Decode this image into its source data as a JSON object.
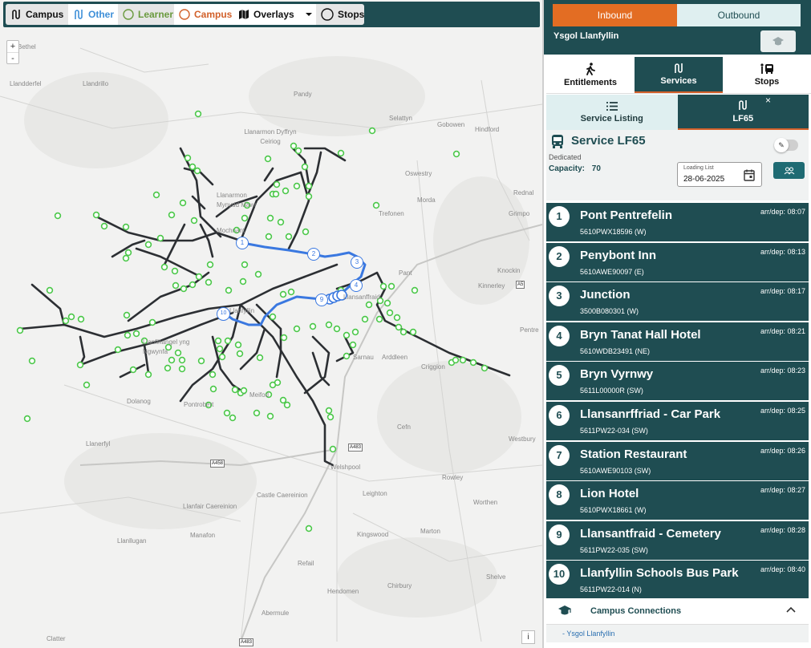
{
  "toolbar": {
    "campus_label": "Campus",
    "other_label": "Other",
    "learner_label": "Learner",
    "campus2_label": "Campus",
    "overlays_label": "Overlays",
    "stops_label": "Stops"
  },
  "map": {
    "zoom_in": "+",
    "zoom_out": "-",
    "info": "i",
    "places": [
      "Bethel",
      "Llandderfel",
      "Llandrillo",
      "Pandy",
      "Llanarmon Dyffryn Ceiriog",
      "Selattyn",
      "Gobowen",
      "Hindford",
      "Llanarmon Mynydd Mawr",
      "Oswestry",
      "Mochnant",
      "Morda",
      "Rednal",
      "Trefonen",
      "Grimpo",
      "Pant",
      "Knockin",
      "Kinnerley",
      "Llanfyllin",
      "Llanfihangel yng Ngwynfa",
      "Llansanffraid",
      "Arddleen",
      "Sarnau",
      "Criggion",
      "Pentre",
      "Dolanog",
      "Pontrobert",
      "Meifod",
      "Llanerfyl",
      "Cefn",
      "Welshpool",
      "Westbury",
      "Llanfair Caereinion",
      "Castle Caereinion",
      "Leighton",
      "Rowley",
      "Worthen",
      "Manafon",
      "Llanllugan",
      "Kingswood",
      "Marton",
      "Refail",
      "Chirbury",
      "Shelve",
      "Hendomen",
      "Abermule",
      "Clatter"
    ],
    "roads": [
      "A5",
      "A483",
      "A458",
      "A483"
    ],
    "route_stop_labels": [
      "1",
      "2",
      "3",
      "4",
      "9",
      "10"
    ]
  },
  "panel": {
    "inbound": "Inbound",
    "outbound": "Outbound",
    "school": "Ysgol Llanfyllin",
    "tabs": [
      {
        "label": "Entitlements"
      },
      {
        "label": "Services"
      },
      {
        "label": "Stops"
      }
    ],
    "subtabs": [
      {
        "label": "Service Listing"
      },
      {
        "label": "LF65",
        "close": "×"
      }
    ],
    "service": {
      "title": "Service LF65",
      "type": "Dedicated",
      "capacity_label": "Capacity:",
      "capacity": "70",
      "loading_list_label": "Loading List",
      "loading_list_date": "28-06-2025"
    },
    "stops": [
      {
        "num": "1",
        "name": "Pont Pentrefelin",
        "code": "5610PWX18596 (W)",
        "time": "arr/dep: 08:07"
      },
      {
        "num": "2",
        "name": "Penybont Inn",
        "code": "5610AWE90097 (E)",
        "time": "arr/dep: 08:13"
      },
      {
        "num": "3",
        "name": "Junction",
        "code": "3500B080301 (W)",
        "time": "arr/dep: 08:17"
      },
      {
        "num": "4",
        "name": "Bryn Tanat Hall Hotel",
        "code": "5610WDB23491 (NE)",
        "time": "arr/dep: 08:21"
      },
      {
        "num": "5",
        "name": "Bryn Vyrnwy",
        "code": "5611L00000R (SW)",
        "time": "arr/dep: 08:23"
      },
      {
        "num": "6",
        "name": "Llansanrffriad - Car Park",
        "code": "5611PW22-034 (SW)",
        "time": "arr/dep: 08:25"
      },
      {
        "num": "7",
        "name": "Station Restaurant",
        "code": "5610AWE90103 (SW)",
        "time": "arr/dep: 08:26"
      },
      {
        "num": "8",
        "name": "Lion Hotel",
        "code": "5610PWX18661 (W)",
        "time": "arr/dep: 08:27"
      },
      {
        "num": "9",
        "name": "Llansantfraid - Cemetery",
        "code": "5611PW22-035 (SW)",
        "time": "arr/dep: 08:28"
      },
      {
        "num": "10",
        "name": "Llanfyllin Schools Bus Park",
        "code": "5611PW22-014 (N)",
        "time": "arr/dep: 08:40"
      }
    ],
    "connections": {
      "title": "Campus Connections",
      "item": "- Ysgol Llanfyllin"
    }
  },
  "colors": {
    "primary": "#1f4d52",
    "accent_orange": "#e36d23",
    "route_blue": "#3a78e0",
    "stop_green": "#4cc84a",
    "road_dark": "#2c2f33"
  }
}
